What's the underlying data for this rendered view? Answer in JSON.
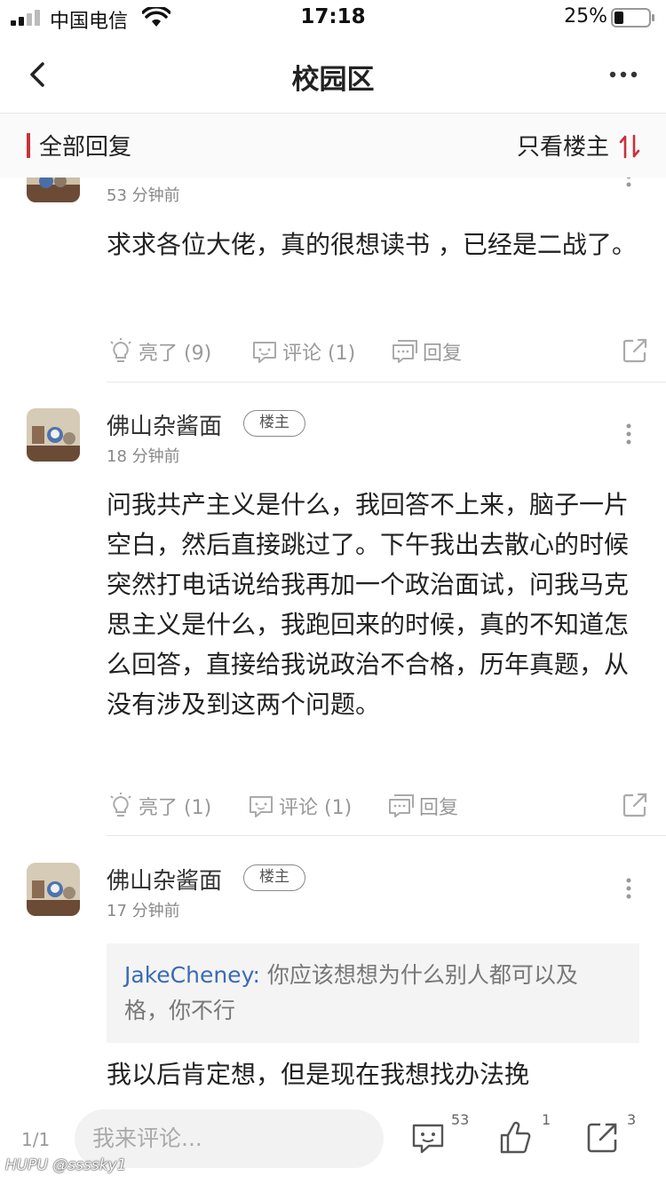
{
  "status_bar": {
    "carrier": "中国电信",
    "time": "17:18",
    "battery": "25%"
  },
  "nav": {
    "title": "校园区"
  },
  "filter": {
    "all_replies": "全部回复",
    "owner_only": "只看楼主"
  },
  "posts": [
    {
      "time": "53 分钟前",
      "text": "求求各位大佬，真的很想读书 ，已经是二战了。",
      "like": "亮了 (9)",
      "comment": "评论 (1)",
      "reply": "回复"
    },
    {
      "username": "佛山杂酱面",
      "badge": "楼主",
      "time": "18 分钟前",
      "text": "问我共产主义是什么，我回答不上来，脑子一片空白，然后直接跳过了。下午我出去散心的时候突然打电话说给我再加一个政治面试，问我马克思主义是什么，我跑回来的时候，真的不知道怎么回答，直接给我说政治不合格，历年真题，从没有涉及到这两个问题。",
      "like": "亮了 (1)",
      "comment": "评论 (1)",
      "reply": "回复"
    },
    {
      "username": "佛山杂酱面",
      "badge": "楼主",
      "time": "17 分钟前",
      "quote_user": "JakeCheney:",
      "quote_text": " 你应该想想为什么别人都可以及格，你不行",
      "text": "我以后肯定想，但是现在我想找办法挽"
    }
  ],
  "bottom": {
    "page": "1/1",
    "comment_placeholder": "我来评论...",
    "comment_count": "53",
    "like_count": "1",
    "share_count": "3"
  },
  "watermark": "HUPU @ssssky1",
  "colors": {
    "accent": "#c8323a",
    "quote_name": "#3a6bb5"
  }
}
